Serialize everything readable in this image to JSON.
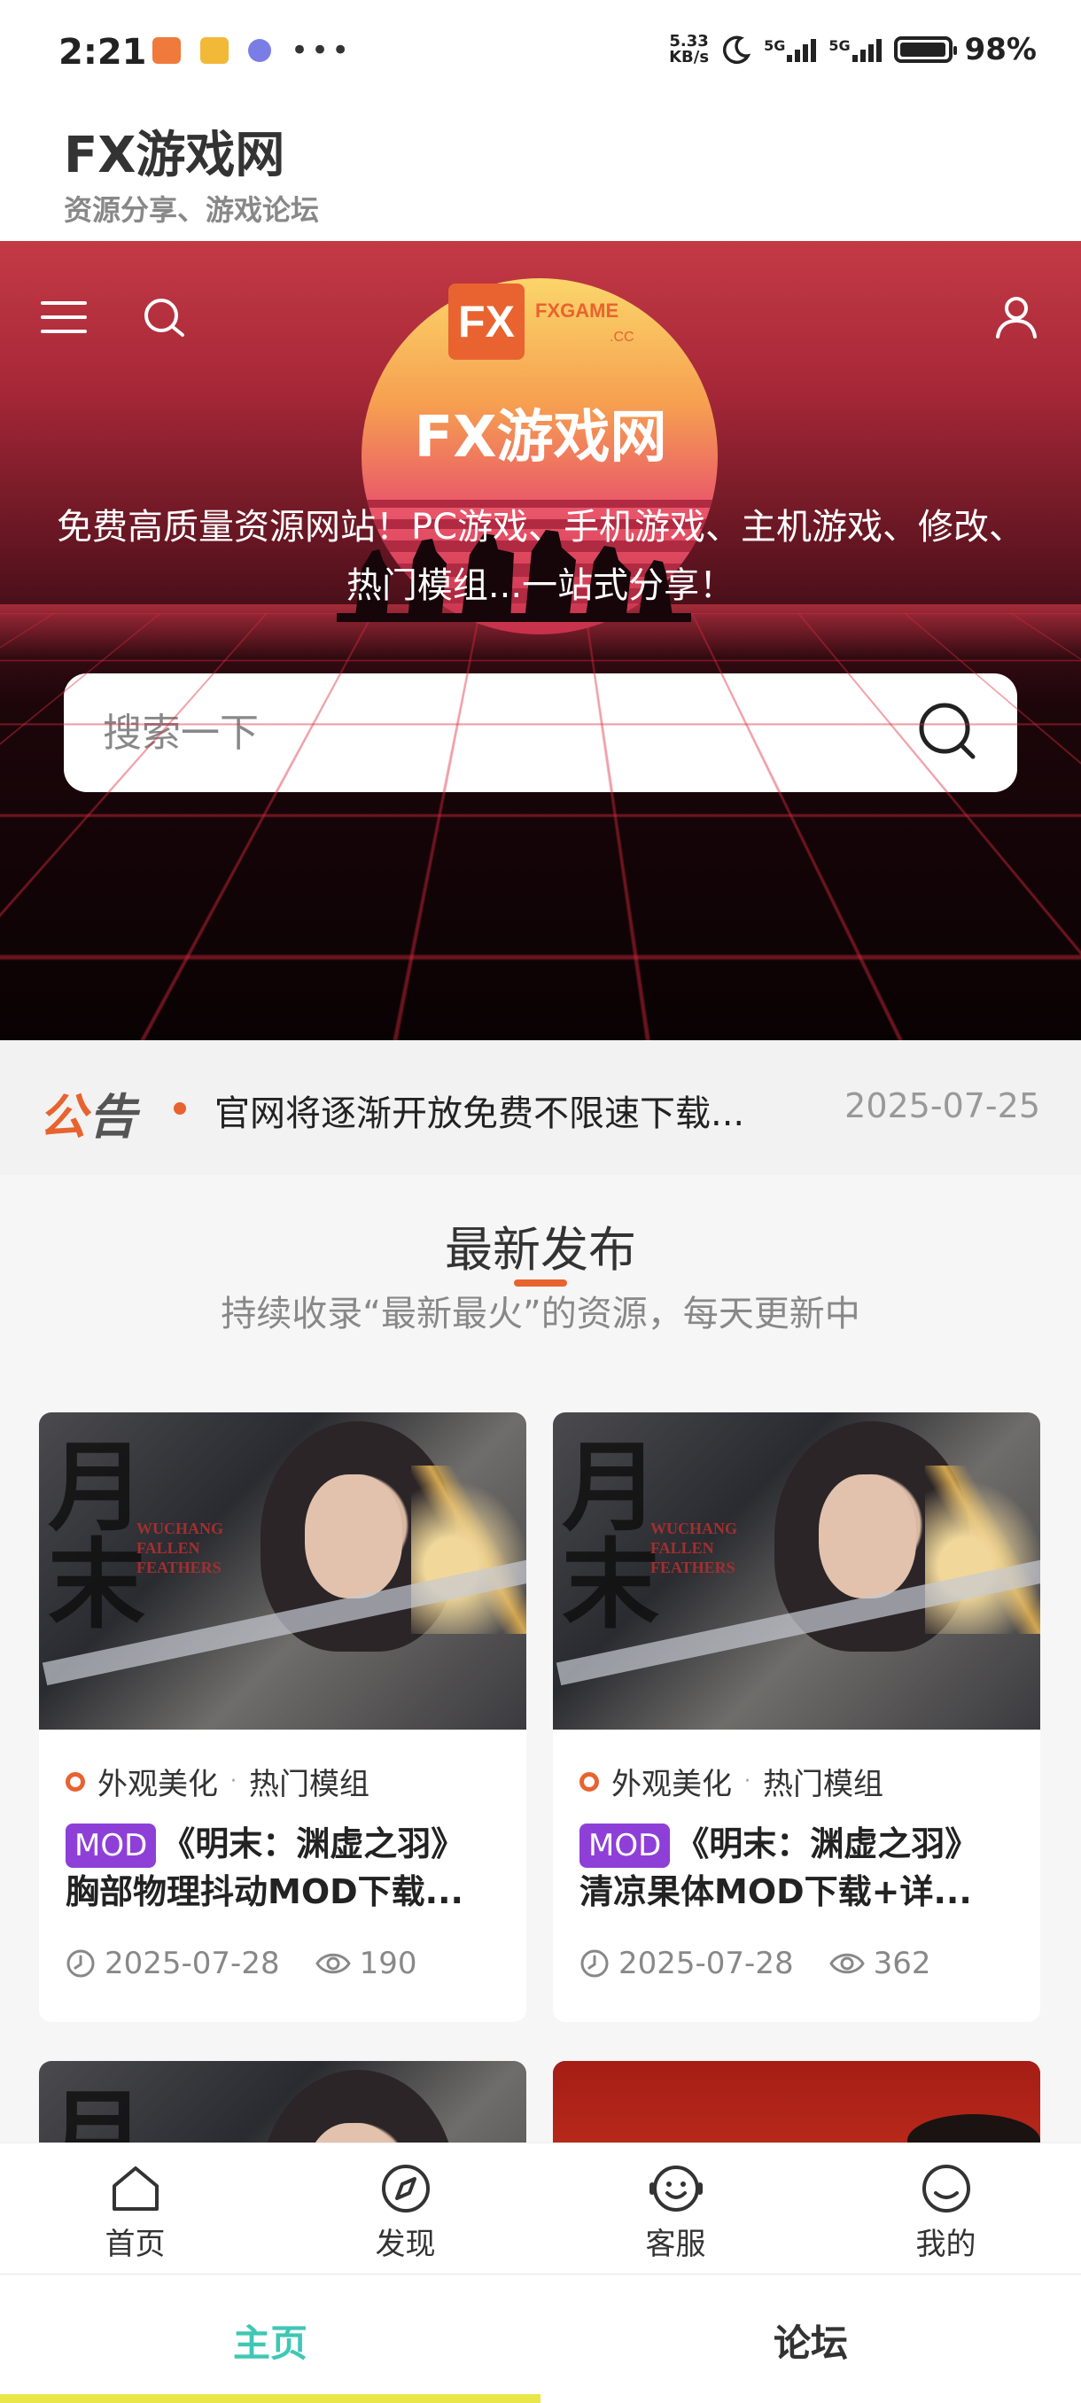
{
  "status_bar": {
    "time": "2:21",
    "net_speed_top": "5.33",
    "net_speed_bottom": "KB/s",
    "sim1": "5G",
    "sim2": "5G",
    "battery": "98%",
    "battery_level": 0.98
  },
  "header": {
    "title": "FX游戏网",
    "subtitle": "资源分享、游戏论坛"
  },
  "hero": {
    "logo_mark": "FX",
    "logo_text": "FXGAME",
    "logo_cc": ".CC",
    "title": "FX游戏网",
    "description": "免费高质量资源网站！PC游戏、手机游戏、主机游戏、修改、热门模组...一站式分享！",
    "search_placeholder": "搜索一下",
    "search_value": ""
  },
  "notice": {
    "label_part1": "公",
    "label_part2": "告",
    "text": "官网将逐渐开放免费不限速下载...",
    "date": "2025-07-25"
  },
  "section": {
    "title": "最新发布",
    "subtitle": "持续收录“最新最火”的资源，每天更新中"
  },
  "cards": [
    {
      "tag1": "外观美化",
      "tag2": "热门模组",
      "badge": "MOD",
      "title_line1": "《明末：渊虚之羽》",
      "title_line2": "胸部物理抖动MOD下载...",
      "date": "2025-07-28",
      "views": "190"
    },
    {
      "tag1": "外观美化",
      "tag2": "热门模组",
      "badge": "MOD",
      "title_line1": "《明末：渊虚之羽》",
      "title_line2": "清凉果体MOD下载+详...",
      "date": "2025-07-28",
      "views": "362"
    }
  ],
  "bottom_nav": [
    {
      "label": "首页",
      "icon": "home-icon"
    },
    {
      "label": "发现",
      "icon": "compass-icon"
    },
    {
      "label": "客服",
      "icon": "smile-icon"
    },
    {
      "label": "我的",
      "icon": "user-face-icon"
    }
  ],
  "tabs": {
    "home": "主页",
    "forum": "论坛"
  },
  "colors": {
    "accent": "#e8632f",
    "mod_badge": "#8e3fd8",
    "tab_active": "#3fc7b5",
    "tab_indicator": "#e9e64a"
  }
}
